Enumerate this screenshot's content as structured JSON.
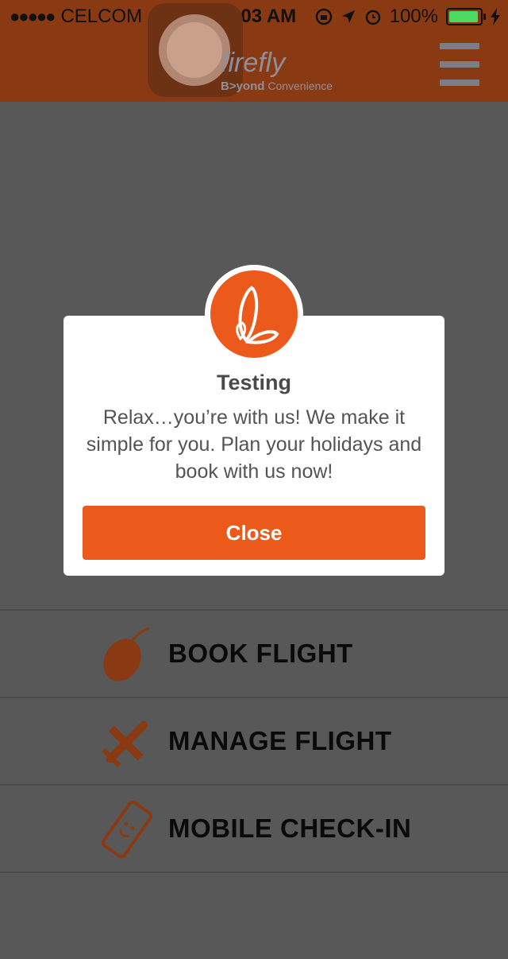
{
  "status_bar": {
    "carrier": "CELCOM",
    "signal_dots": "●●●●●",
    "time": "11:03 AM",
    "battery_percent": "100%"
  },
  "header": {
    "brand": "firefly",
    "tagline_bold": "B>yond",
    "tagline_rest": "Convenience"
  },
  "dialog": {
    "title": "Testing",
    "message": "Relax…you’re with us! We make it simple for you. Plan your holidays and book with us now!",
    "close_label": "Close"
  },
  "menu": {
    "items": [
      {
        "label": "BOOK FLIGHT",
        "icon": "mouse-icon"
      },
      {
        "label": "MANAGE FLIGHT",
        "icon": "airplane-icon"
      },
      {
        "label": "MOBILE CHECK-IN",
        "icon": "mobile-phone-icon"
      }
    ]
  },
  "colors": {
    "brand_orange": "#ec5a1b",
    "header_dim": "#8a3a12",
    "battery_green": "#4cd964"
  }
}
